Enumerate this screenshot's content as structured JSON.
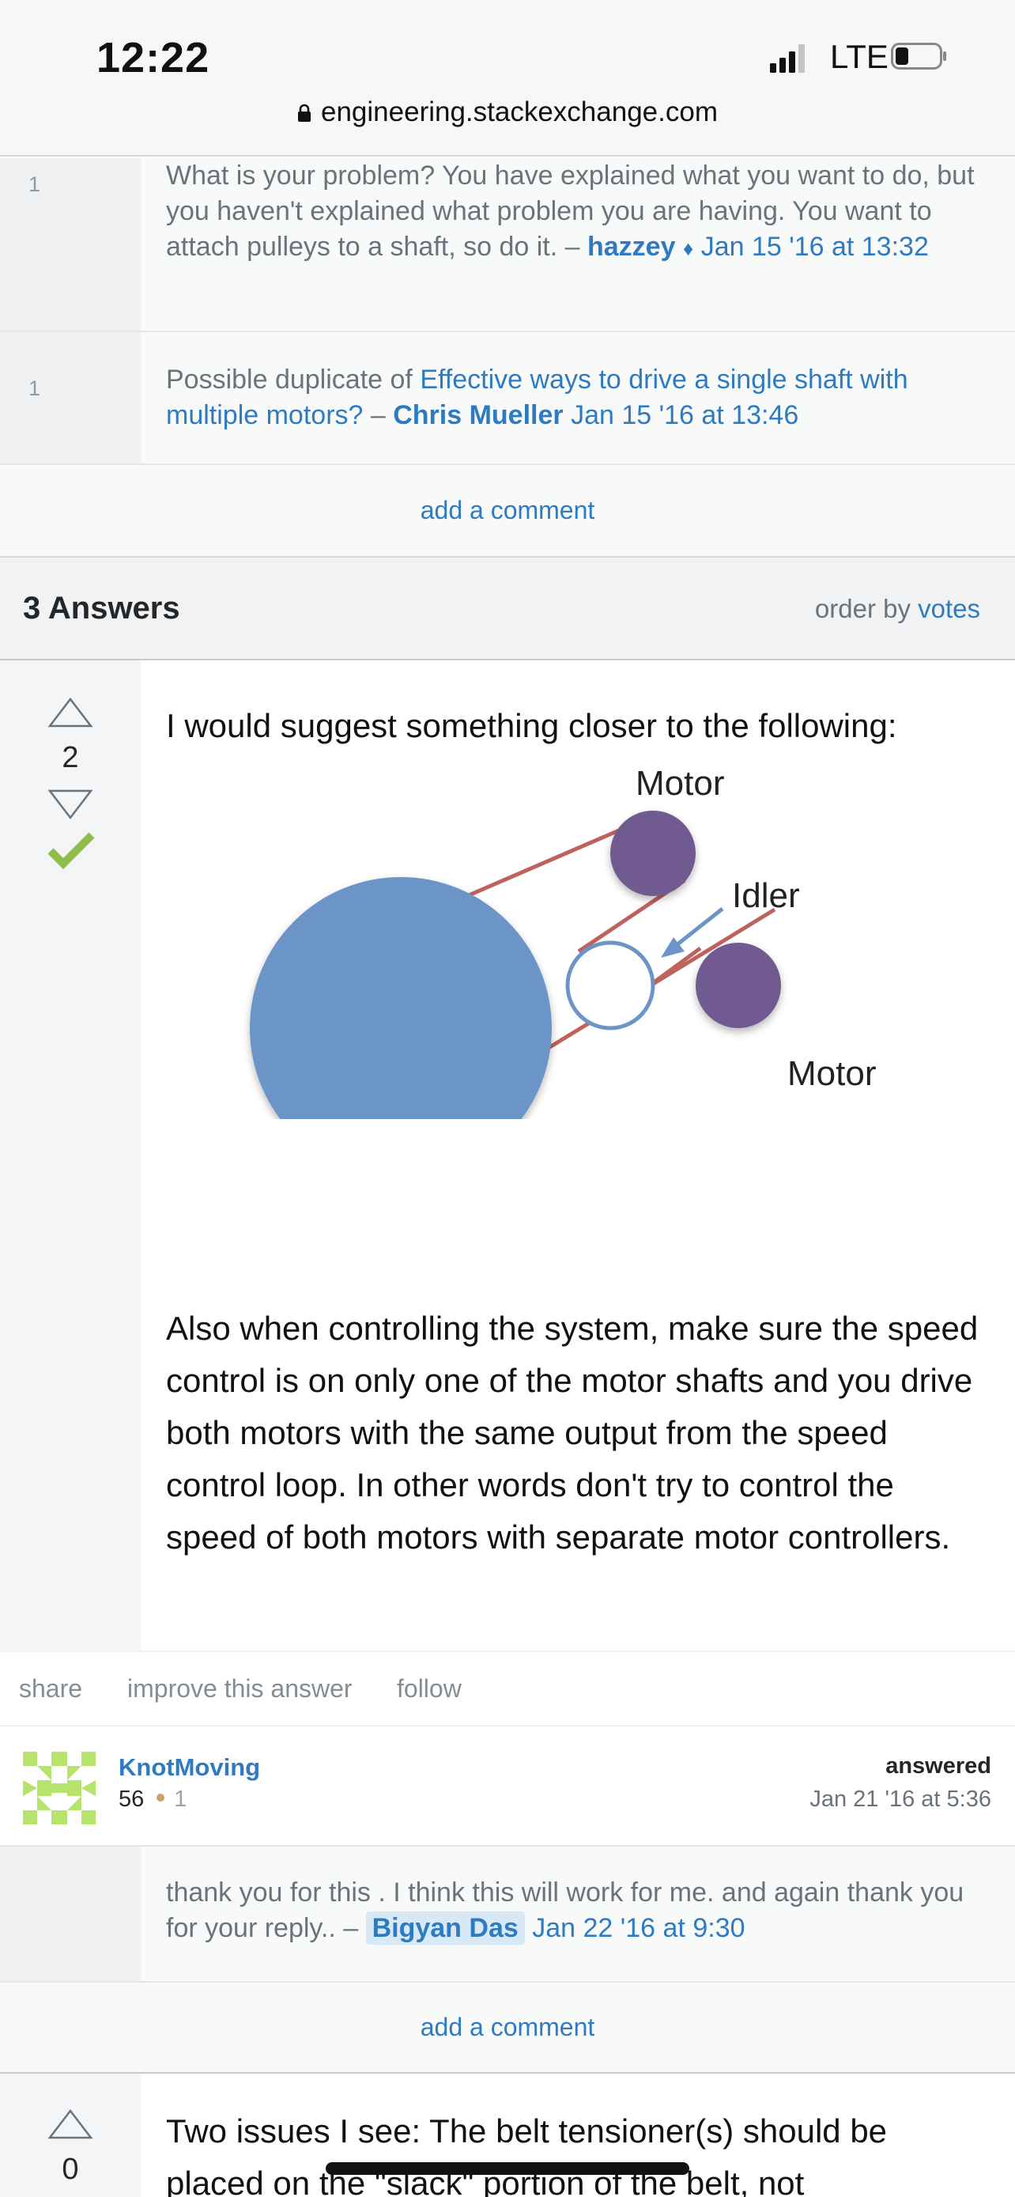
{
  "status_bar": {
    "time": "12:22",
    "network": "LTE",
    "url": "engineering.stackexchange.com"
  },
  "comments": [
    {
      "score": "1",
      "text": "What is your problem? You have explained what you want to do, but you haven't explained what problem you are having. You want to attach pulleys to a shaft, so do it.",
      "sep": " – ",
      "user": "hazzey",
      "mod": "♦",
      "time": "Jan 15 '16 at 13:32"
    },
    {
      "score": "1",
      "text_prefix": "Possible duplicate of ",
      "link": "Effective ways to drive a single shaft with multiple motors?",
      "sep": " – ",
      "user": "Chris Mueller",
      "time": "Jan 15 '16 at 13:46"
    }
  ],
  "add_comment_label": "add a comment",
  "answers_header": {
    "count": "3 Answers",
    "order_prefix": "order by ",
    "order_link": "votes"
  },
  "answer1": {
    "votes": "2",
    "intro": "I would suggest something closer to the following:",
    "diagram": {
      "motor_top": "Motor",
      "idler": "Idler",
      "motor_right": "Motor"
    },
    "paragraph": "Also when controlling the system, make sure the speed control is on only one of the motor shafts and you drive both motors with the same output from the speed control loop. In other words don't try to control the speed of both motors with separate motor controllers.",
    "menu": {
      "share": "share",
      "improve": "improve this answer",
      "follow": "follow"
    },
    "signature": {
      "action": "answered",
      "time": "Jan 21 '16 at 5:36",
      "user": "KnotMoving",
      "rep": "56",
      "bronze": "1"
    },
    "reply": {
      "text": "thank you for this . I think this will work for me. and again thank you for your reply..",
      "sep": " – ",
      "user": "Bigyan Das",
      "time": "Jan 22 '16 at 9:30"
    }
  },
  "answer2": {
    "votes": "0",
    "text": "Two issues I see: The belt tensioner(s) should be placed on the \"slack\" portion of the belt, not"
  },
  "colors": {
    "link": "#2f7bc1",
    "accepted": "#8ebd4b",
    "pulley_large": "#6b95c6",
    "motor": "#6f5a8f",
    "belt": "#c0625c"
  }
}
